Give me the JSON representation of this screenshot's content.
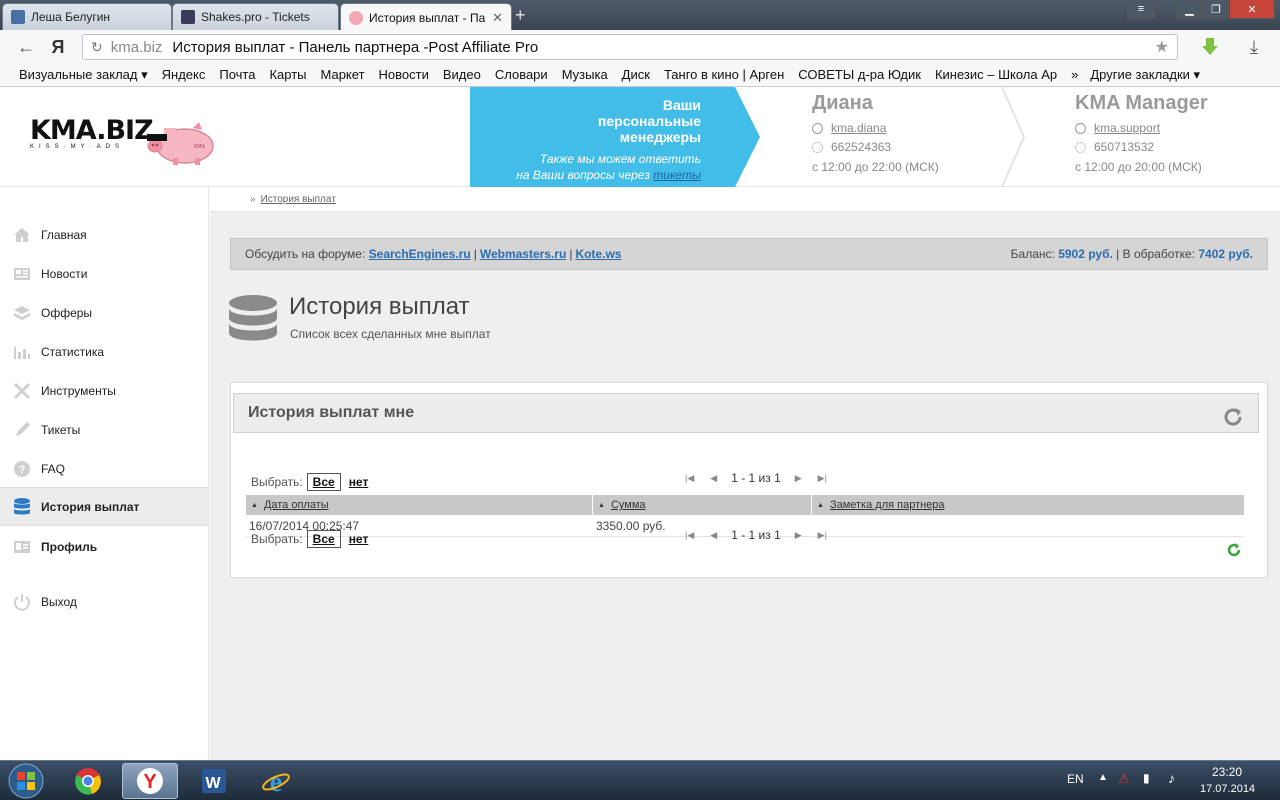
{
  "browser": {
    "tabs": [
      {
        "label": "Леша Белугин"
      },
      {
        "label": "Shakes.pro - Tickets"
      },
      {
        "label": "История выплат - Па"
      }
    ],
    "url_domain": "kma.biz",
    "url_title": "История выплат - Панель партнера -Post Affiliate Pro",
    "bookmarks": [
      "Визуальные заклад",
      "Яндекс",
      "Почта",
      "Карты",
      "Маркет",
      "Новости",
      "Видео",
      "Словари",
      "Музыка",
      "Диск",
      "Танго в кино | Арген",
      "СОВЕТЫ д-ра Юдик",
      "Кинезис – Школа Ар"
    ],
    "bookmarks_more": "Другие закладки"
  },
  "header": {
    "logo": "KMA.BIZ",
    "logo_sub": "KISS·MY·ADS",
    "banner_title_1": "Ваши",
    "banner_title_2": "персональные",
    "banner_title_3": "менеджеры",
    "banner_sub_1": "Также мы можем ответить",
    "banner_sub_2": "на Ваши вопросы через",
    "banner_link": "тикеты",
    "managers": [
      {
        "name": "Диана",
        "skype": "kma.diana",
        "icq": "662524363",
        "hours": "с 12:00 до 22:00 (МСК)"
      },
      {
        "name": "KMA Manager",
        "skype": "kma.support",
        "icq": "650713532",
        "hours": "с 12:00 до 20:00 (МСК)"
      }
    ]
  },
  "sidebar": {
    "items": [
      {
        "label": "Главная",
        "icon": "home-icon"
      },
      {
        "label": "Новости",
        "icon": "news-icon"
      },
      {
        "label": "Офферы",
        "icon": "offers-icon"
      },
      {
        "label": "Статистика",
        "icon": "stats-icon"
      },
      {
        "label": "Инструменты",
        "icon": "tools-icon"
      },
      {
        "label": "Тикеты",
        "icon": "tickets-icon"
      },
      {
        "label": "FAQ",
        "icon": "faq-icon"
      },
      {
        "label": "История выплат",
        "icon": "database-icon"
      },
      {
        "label": "Профиль",
        "icon": "profile-icon"
      },
      {
        "label": "Выход",
        "icon": "power-icon"
      }
    ]
  },
  "breadcrumb": {
    "current": "История выплат"
  },
  "forum": {
    "prefix": "Обсудить на форуме:",
    "links": [
      "SearchEngines.ru",
      "Webmasters.ru",
      "Kote.ws"
    ],
    "balance_label": "Баланс:",
    "balance_value": "5902 руб.",
    "processing_label": "| В обработке:",
    "processing_value": "7402 руб."
  },
  "page": {
    "title": "История выплат",
    "subtitle": "Список всех сделанных мне выплат"
  },
  "panel": {
    "title": "История выплат мне",
    "select_label": "Выбрать:",
    "select_all": "Все",
    "select_none": "нет",
    "pager_text": "1 - 1 из 1",
    "columns": [
      "Дата оплаты",
      "Сумма",
      "Заметка для партнера"
    ],
    "rows": [
      {
        "date": "16/07/2014 00:25:47",
        "amount": "3350.00 руб.",
        "note": ""
      }
    ]
  },
  "taskbar": {
    "lang": "EN",
    "time": "23:20",
    "date": "17.07.2014"
  },
  "colors": {
    "accent_blue": "#42bde7",
    "link_blue": "#2a6db0"
  }
}
